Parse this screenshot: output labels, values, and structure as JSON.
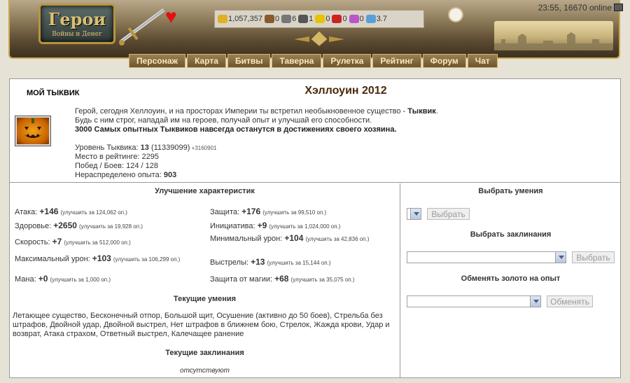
{
  "header": {
    "logo_title": "Герои",
    "logo_subtitle": "Войны и Денег",
    "time_status": "23:55, 16670 online",
    "resources": [
      {
        "icon": "gold-icon",
        "value": "1,057,357",
        "color": "#e0b020"
      },
      {
        "icon": "wood-icon",
        "value": "0",
        "color": "#8a5a2a"
      },
      {
        "icon": "ore-icon",
        "value": "6",
        "color": "#777777"
      },
      {
        "icon": "mercury-icon",
        "value": "1",
        "color": "#555555"
      },
      {
        "icon": "sulfur-icon",
        "value": "0",
        "color": "#e8c400"
      },
      {
        "icon": "crystal-icon",
        "value": "0",
        "color": "#cc2222"
      },
      {
        "icon": "gems-icon",
        "value": "0",
        "color": "#bb55cc"
      },
      {
        "icon": "diamond-icon",
        "value": "3.7",
        "color": "#5aa0d8"
      }
    ],
    "nav": [
      "Персонаж",
      "Карта",
      "Битвы",
      "Таверна",
      "Рулетка",
      "Рейтинг",
      "Форум",
      "Чат"
    ]
  },
  "pet": {
    "label": "МОЙ ТЫКВИК",
    "event_title": "Хэллоуин 2012",
    "desc_line1_pre": "Герой, сегодня Хеллоуин, и на просторах Империи ты встретил необыкновенное существо - ",
    "desc_line1_bold": "Тыквик",
    "desc_line1_post": ".",
    "desc_line2": "Будь с ним строг, нападай им на героев, получай опыт и улучшай его способности.",
    "desc_line3": "3000 Самых опытных Тыквиков навсегда останутся в достижениях своего хозяина.",
    "level_label": "Уровень Тыквика: ",
    "level_value": "13",
    "level_exp": " (11339099)",
    "level_plus": " +3160901",
    "rating_label": "Место в рейтинге: ",
    "rating_value": "2295",
    "wins_label": "Побед / Боев: ",
    "wins_value": "124 / 128",
    "unspent_label": "Нераспределено опыта: ",
    "unspent_value": "903"
  },
  "upgrade": {
    "title": "Улучшение характеристик",
    "stats": [
      {
        "label": "Атака: ",
        "value": "+146",
        "cost": "(улучшить за 124,062 оп.)"
      },
      {
        "label": "Здоровье: ",
        "value": "+2650",
        "cost": "(улучшить за 19,928 оп.)"
      },
      {
        "label": "Скорость: ",
        "value": "+7",
        "cost": "(улучшить за 512,000 оп.)"
      },
      {
        "label": "Максимальный урон: ",
        "value": "+103",
        "cost": "(улучшить за 106,299 оп.)"
      },
      {
        "label": "Мана: ",
        "value": "+0",
        "cost": "(улучшить за 1,000 оп.)"
      },
      {
        "label": "Защита: ",
        "value": "+176",
        "cost": "(улучшить за 99,510 оп.)"
      },
      {
        "label": "Инициатива: ",
        "value": "+9",
        "cost": "(улучшить за 1,024,000 оп.)"
      },
      {
        "label": "Минимальный урон: ",
        "value": "+104",
        "cost": "(улучшить за 42,836 оп.)"
      },
      {
        "label": "Выстрелы: ",
        "value": "+13",
        "cost": "(улучшить за 15,144 оп.)"
      },
      {
        "label": "Защита от магии: ",
        "value": "+68",
        "cost": "(улучшить за 35,075 оп.)"
      }
    ]
  },
  "skills": {
    "title": "Текущие умения",
    "text": "Летающее существо, Бесконечный отпор, Большой щит, Осушение (активно до 50 боев), Стрельба без штрафов, Двойной удар, Двойной выстрел, Нет штрафов в ближнем бою, Стрелок, Жажда крови, Удар и возврат, Атака страхом, Ответный выстрел, Калечащее ранение"
  },
  "spells": {
    "title": "Текущие заклинания",
    "none": "отсутствуют"
  },
  "right": {
    "choose_skills_title": "Выбрать умения",
    "choose_skills_btn": "Выбрать",
    "choose_spells_title": "Выбрать заклинания",
    "choose_spells_btn": "Выбрать",
    "exchange_title": "Обменять золото на опыт",
    "exchange_btn": "Обменять"
  }
}
